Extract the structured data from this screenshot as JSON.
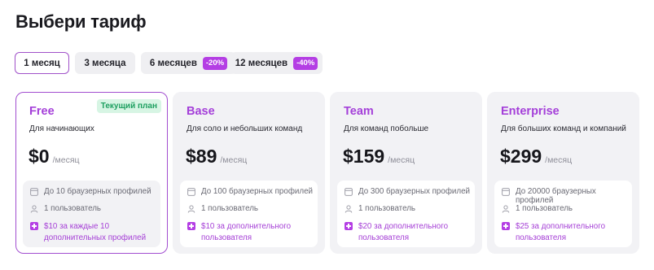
{
  "page": {
    "title": "Выбери тариф"
  },
  "tabs": [
    {
      "label": "1 месяц",
      "active": true,
      "discount": ""
    },
    {
      "label": "3 месяца",
      "active": false,
      "discount": ""
    },
    {
      "label": "6 месяцев",
      "active": false,
      "discount": "-20%"
    },
    {
      "label": "12 месяцев",
      "active": false,
      "discount": "-40%"
    }
  ],
  "plans": [
    {
      "name": "Free",
      "badge": "Текущий план",
      "description": "Для начинающих",
      "price": "$0",
      "period": "/месяц",
      "features": [
        "До 10 браузерных профилей",
        "1 пользователь"
      ],
      "addon_line1": "$10 за каждые 10",
      "addon_line2": "дополнительных профилей"
    },
    {
      "name": "Base",
      "description": "Для соло и небольших команд",
      "price": "$89",
      "period": "/месяц",
      "features": [
        "До 100 браузерных профилей",
        "1 пользователь"
      ],
      "addon_line1": "$10 за дополнительного",
      "addon_line2": "пользователя"
    },
    {
      "name": "Team",
      "description": "Для команд побольше",
      "price": "$159",
      "period": "/месяц",
      "features": [
        "До 300 браузерных профилей",
        "1 пользователь"
      ],
      "addon_line1": "$20 за дополнительного",
      "addon_line2": "пользователя"
    },
    {
      "name": "Enterprise",
      "description": "Для больших команд и компаний",
      "price": "$299",
      "period": "/месяц",
      "features": [
        "До 20000 браузерных профилей",
        "1 пользователь"
      ],
      "addon_line1": "$25 за дополнительного",
      "addon_line2": "пользователя"
    }
  ],
  "colors": {
    "accent": "#b43ee4",
    "plan_name": "#a43fd9",
    "badge_bg": "#d7f5e4",
    "badge_text": "#1d9f60"
  },
  "icons": {
    "profiles": "browser-icon",
    "users": "user-icon",
    "addon": "plus-icon"
  }
}
